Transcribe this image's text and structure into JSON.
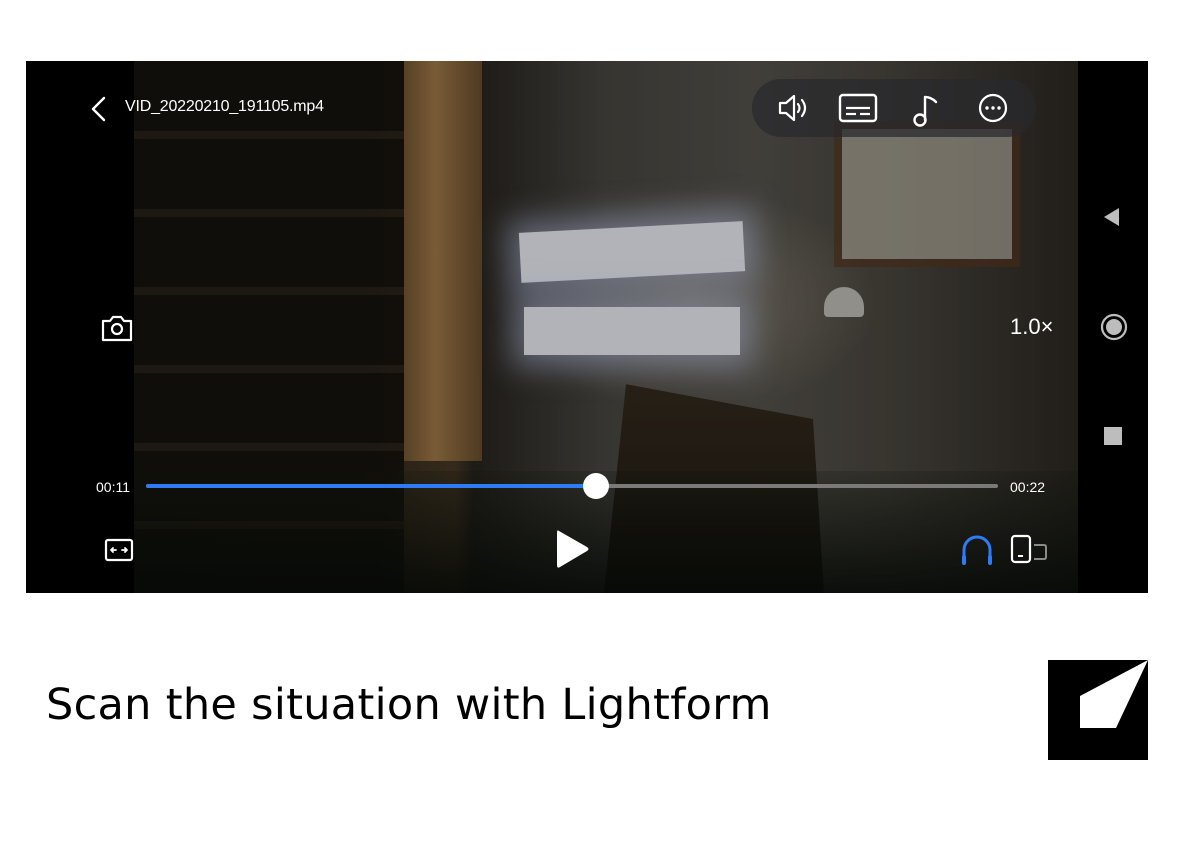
{
  "player": {
    "file_name": "VID_20220210_191105.mp4",
    "speed_label": "1.0×",
    "current_time": "00:11",
    "total_time": "00:22",
    "progress": 0.5287
  },
  "icons": {
    "back": "chevron-left-icon",
    "volume": "volume-icon",
    "subtitles": "subtitles-icon",
    "music": "music-note-icon",
    "more": "more-options-icon",
    "screenshot": "camera-icon",
    "aspect": "aspect-ratio-icon",
    "play": "play-icon",
    "audio": "headphones-icon",
    "float": "floating-window-icon"
  },
  "caption": {
    "text": "Scan the situation with Lightform"
  },
  "colors": {
    "accent": "#2d7cf6",
    "pill_bg": "#28282c"
  }
}
